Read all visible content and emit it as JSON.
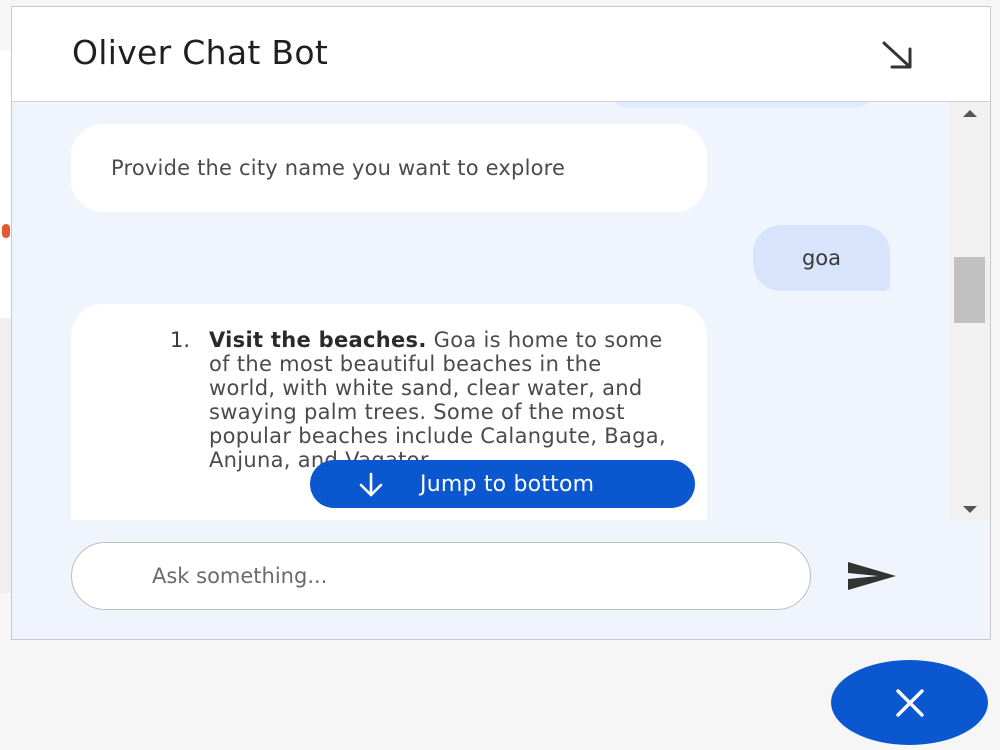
{
  "header": {
    "title": "Oliver Chat Bot",
    "minimize_icon": "arrow-down-right-icon"
  },
  "messages": [
    {
      "sender": "bot",
      "text": "Provide the city name you want to explore"
    },
    {
      "sender": "user",
      "text": "goa"
    },
    {
      "sender": "bot",
      "list_number": "1.",
      "bold": "Visit the beaches.",
      "text": " Goa is home to some of the most beautiful beaches in the world, with white sand, clear water, and swaying palm trees. Some of the most popular beaches include Calangute, Baga, Anjuna, and Vagator."
    }
  ],
  "jump_button": {
    "label": "Jump to bottom",
    "icon": "arrow-down-icon"
  },
  "input": {
    "placeholder": "Ask something...",
    "value": ""
  },
  "send_icon": "send-icon",
  "close_icon": "close-icon",
  "colors": {
    "accent": "#0b57d0",
    "chat_background": "#f0f5fd",
    "user_bubble": "#d7e4fb"
  }
}
